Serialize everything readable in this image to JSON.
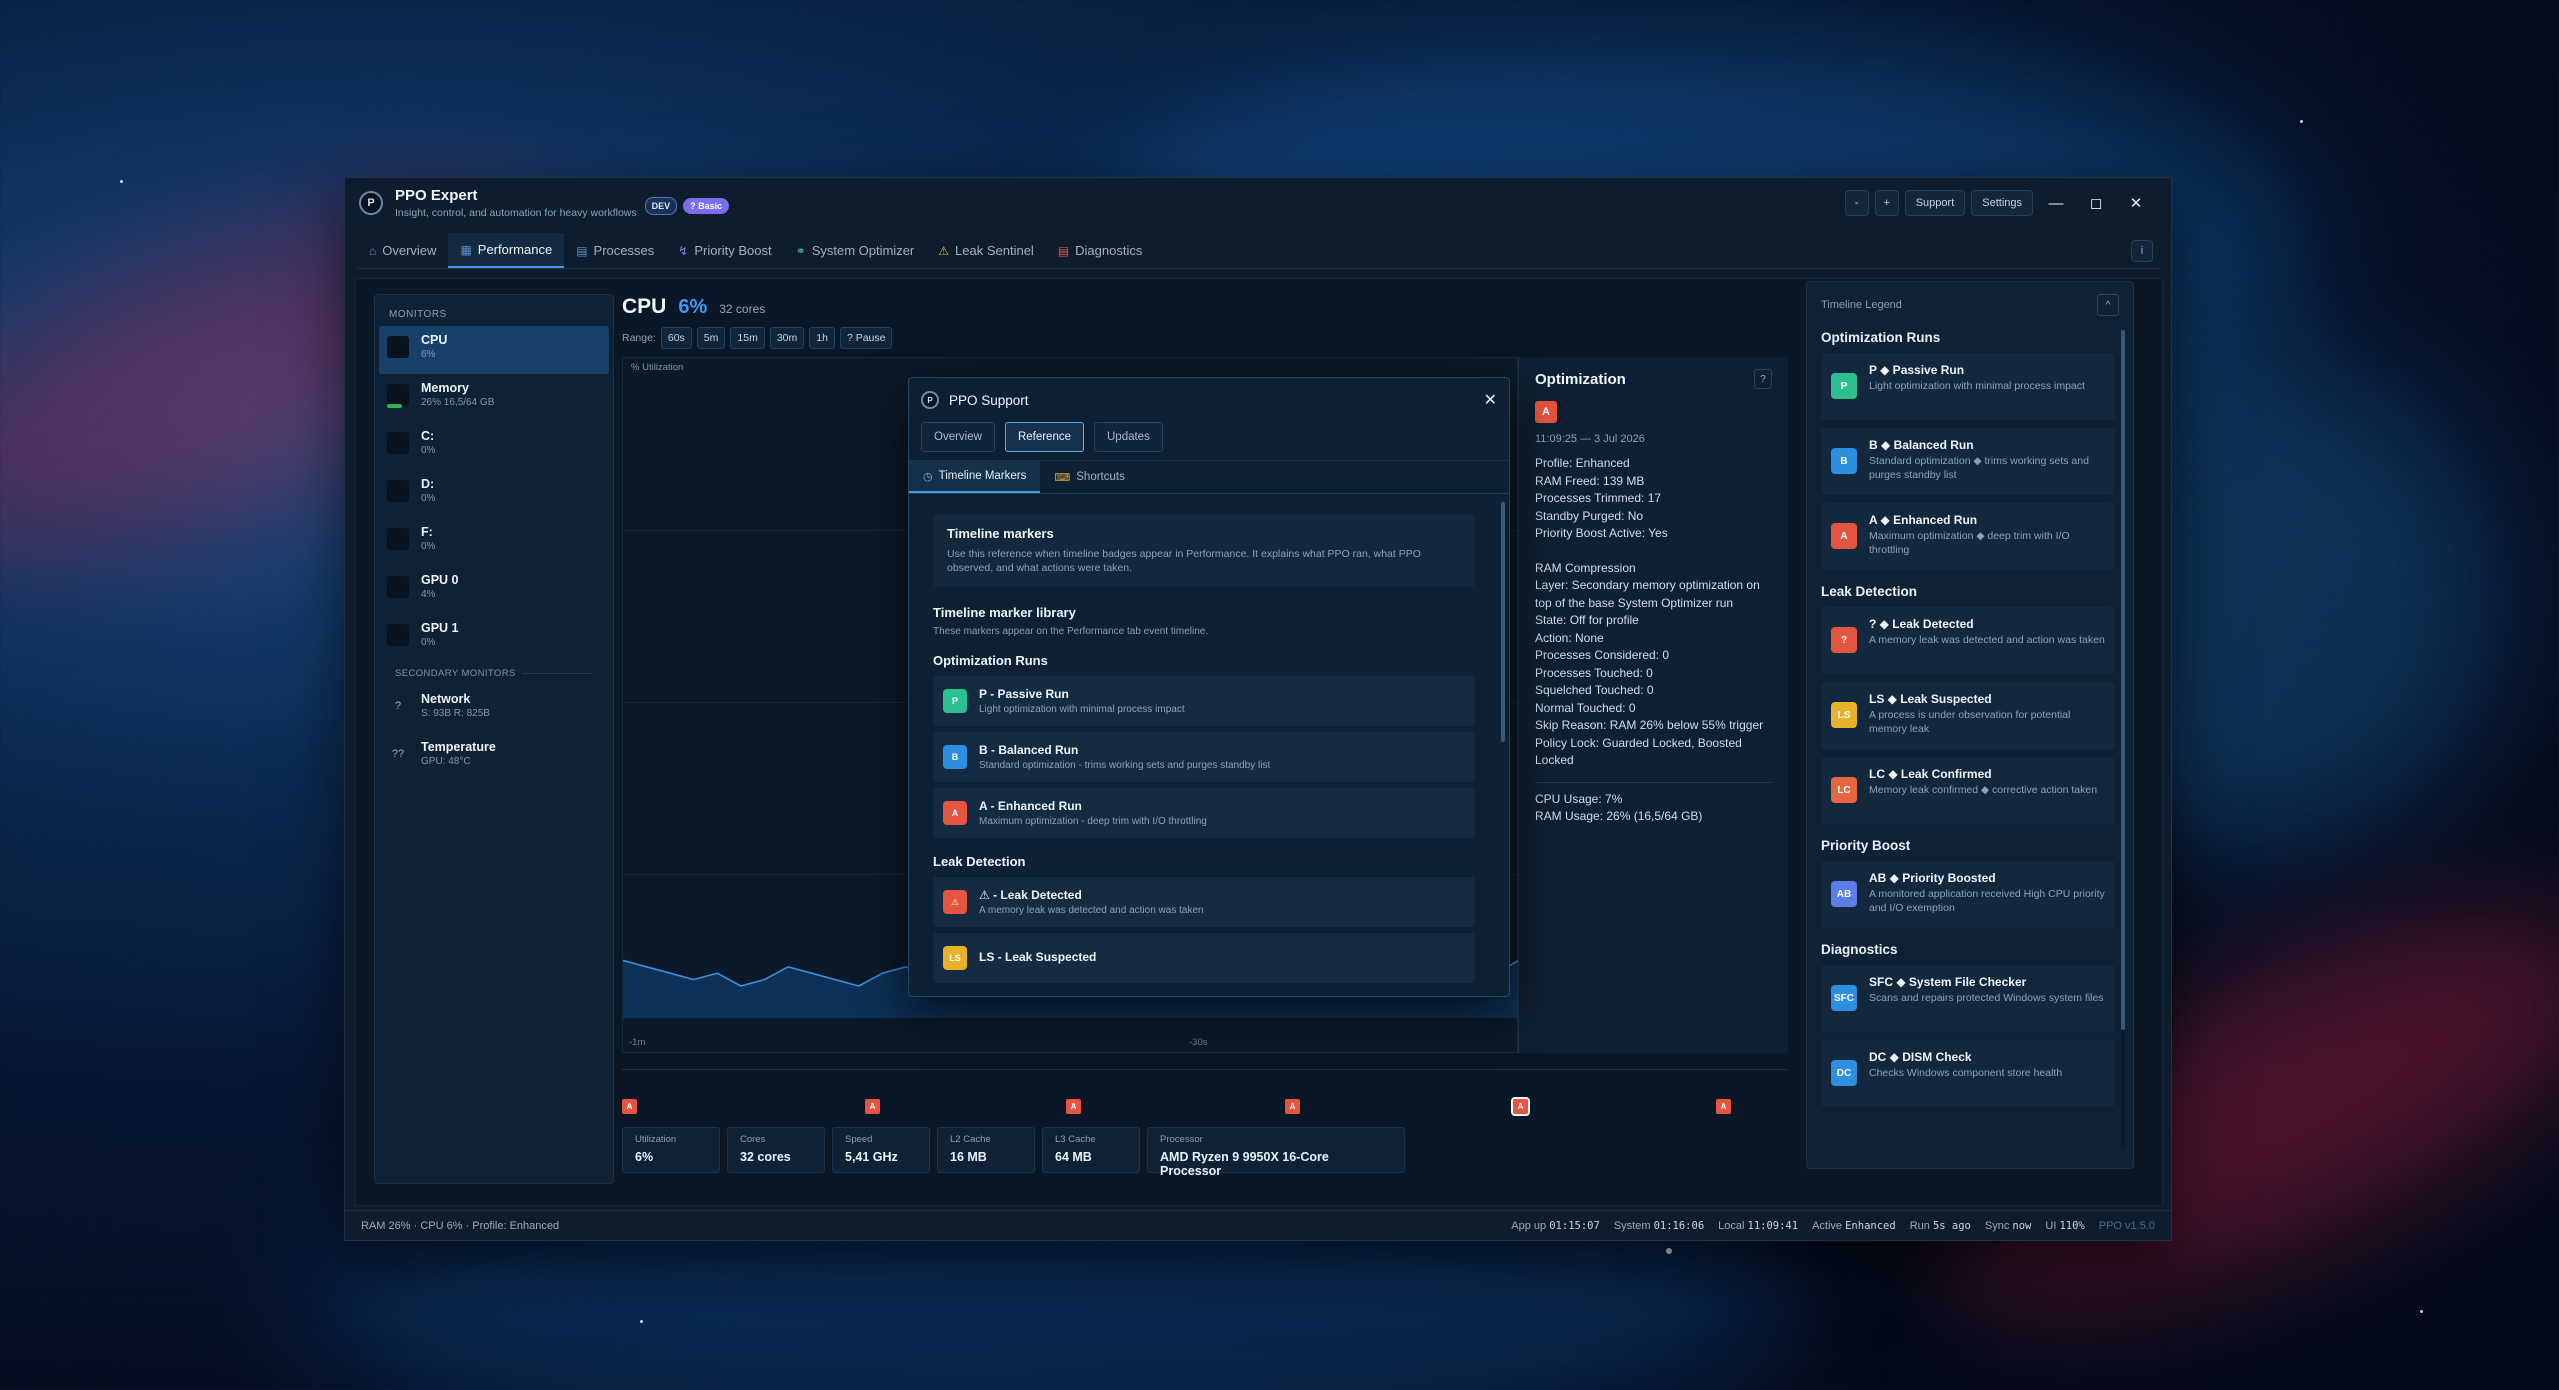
{
  "app": {
    "logo_letter": "P",
    "title": "PPO Expert",
    "subtitle": "Insight, control, and automation for heavy workflows",
    "badge_dev": "DEV",
    "badge_basic": "? Basic",
    "btn_minus": "-",
    "btn_plus": "+",
    "support_label": "Support",
    "settings_label": "Settings"
  },
  "tabs": [
    {
      "label": "Overview",
      "icon": "home-icon"
    },
    {
      "label": "Performance",
      "icon": "chart-icon",
      "active": true
    },
    {
      "label": "Processes",
      "icon": "document-icon"
    },
    {
      "label": "Priority Boost",
      "icon": "lightning-icon"
    },
    {
      "label": "System Optimizer",
      "icon": "gauge-icon"
    },
    {
      "label": "Leak Sentinel",
      "icon": "warning-icon"
    },
    {
      "label": "Diagnostics",
      "icon": "clipboard-icon"
    }
  ],
  "info_label": "i",
  "monitors": {
    "heading": "MONITORS",
    "items": [
      {
        "name": "CPU",
        "value": "6%",
        "active": true
      },
      {
        "name": "Memory",
        "value": "26%  16,5/64 GB",
        "fill_pct": 26
      },
      {
        "name": "C:",
        "value": "0%"
      },
      {
        "name": "D:",
        "value": "0%"
      },
      {
        "name": "F:",
        "value": "0%"
      },
      {
        "name": "GPU 0",
        "value": "4%"
      },
      {
        "name": "GPU 1",
        "value": "0%"
      }
    ],
    "secondary_heading": "SECONDARY MONITORS",
    "secondary": [
      {
        "name": "Network",
        "value": "S: 93B  R: 825B",
        "icon": "?"
      },
      {
        "name": "Temperature",
        "value": "GPU: 48°C",
        "icon": "??"
      }
    ]
  },
  "cpu": {
    "name": "CPU",
    "percent": "6%",
    "cores": "32 cores",
    "range_label": "Range:",
    "ranges": [
      "60s",
      "5m",
      "15m",
      "30m",
      "1h",
      "? Pause"
    ],
    "y_label": "% Utilization",
    "x_labels": [
      "-1m",
      "-30s"
    ]
  },
  "chart_data": {
    "type": "area",
    "title": "",
    "ylabel": "% Utilization",
    "ylim": [
      0,
      100
    ],
    "x_ticks": [
      "-1m",
      "-30s"
    ],
    "values": [
      9,
      8,
      7,
      6,
      7,
      5,
      6,
      8,
      7,
      6,
      5,
      7,
      8,
      6,
      5,
      6,
      7,
      6,
      5,
      6,
      7,
      8,
      6,
      7,
      6,
      7,
      6,
      5,
      6,
      7,
      8,
      7,
      6,
      7,
      8,
      7,
      6,
      7,
      9
    ]
  },
  "optimization": {
    "title": "Optimization",
    "help": "?",
    "badge": "A",
    "timestamp": "11:09:25 — 3 Jul 2026",
    "lines_a": [
      "Profile: Enhanced",
      "RAM Freed: 139 MB",
      "Processes Trimmed: 17",
      "Standby Purged: No",
      "Priority Boost Active: Yes"
    ],
    "lines_b": [
      "RAM Compression",
      "Layer: Secondary memory optimization on top of the base System Optimizer run",
      "State: Off for profile",
      "Action: None",
      "Processes Considered: 0",
      "Processes Touched: 0",
      "Squelched Touched: 0",
      "Normal Touched: 0",
      "Skip Reason: RAM 26% below 55% trigger",
      "Policy Lock: Guarded Locked, Boosted Locked"
    ],
    "lines_c": [
      "CPU Usage: 7%",
      "RAM Usage: 26% (16,5/64 GB)"
    ]
  },
  "markers": [
    "A",
    "A",
    "A",
    "A",
    "A",
    "A"
  ],
  "stats": [
    {
      "key": "Utilization",
      "value": "6%"
    },
    {
      "key": "Cores",
      "value": "32 cores"
    },
    {
      "key": "Speed",
      "value": "5,41 GHz"
    },
    {
      "key": "L2 Cache",
      "value": "16 MB"
    },
    {
      "key": "L3 Cache",
      "value": "64 MB"
    },
    {
      "key": "Processor",
      "value": "AMD Ryzen 9 9950X 16-Core Processor"
    }
  ],
  "legend": {
    "title": "Timeline Legend",
    "collapse": "^",
    "sections": [
      {
        "title": "Optimization Runs",
        "items": [
          {
            "code": "P",
            "title": "P ◆ Passive Run",
            "desc": "Light optimization with minimal process impact",
            "color": "#2cbf8f"
          },
          {
            "code": "B",
            "title": "B ◆ Balanced Run",
            "desc": "Standard optimization ◆ trims working sets and purges standby list",
            "color": "#2d8fe0"
          },
          {
            "code": "A",
            "title": "A ◆ Enhanced Run",
            "desc": "Maximum optimization ◆ deep trim with I/O throttling",
            "color": "#e5553f"
          }
        ]
      },
      {
        "title": "Leak Detection",
        "items": [
          {
            "code": "?",
            "title": "? ◆ Leak Detected",
            "desc": "A memory leak was detected and action was taken",
            "color": "#e5553f"
          },
          {
            "code": "LS",
            "title": "LS ◆ Leak Suspected",
            "desc": "A process is under observation for potential memory leak",
            "color": "#e9b12a"
          },
          {
            "code": "LC",
            "title": "LC ◆ Leak Confirmed",
            "desc": "Memory leak confirmed ◆ corrective action taken",
            "color": "#e5663f"
          }
        ]
      },
      {
        "title": "Priority Boost",
        "items": [
          {
            "code": "AB",
            "title": "AB ◆ Priority Boosted",
            "desc": "A monitored application received High CPU priority and I/O exemption",
            "color": "#5b7de8"
          }
        ]
      },
      {
        "title": "Diagnostics",
        "items": [
          {
            "code": "SFC",
            "title": "SFC ◆ System File Checker",
            "desc": "Scans and repairs protected Windows system files",
            "color": "#2d8fe0"
          },
          {
            "code": "DC",
            "title": "DC ◆ DISM Check",
            "desc": "Checks Windows component store health",
            "color": "#2d8fe0"
          }
        ]
      }
    ]
  },
  "status": {
    "left": [
      "RAM 26%",
      "CPU 6%",
      "Profile: Enhanced"
    ],
    "app_up_label": "App up",
    "app_up": "01:15:07",
    "system_label": "System",
    "system": "01:16:06",
    "local_label": "Local",
    "local": "11:09:41",
    "active_label": "Active",
    "active": "Enhanced",
    "run_label": "Run",
    "run": "5s ago",
    "sync_label": "Sync",
    "sync": "now",
    "ui_label": "UI",
    "ui": "110%",
    "version": "PPO v1.5.0"
  },
  "dialog": {
    "logo_letter": "P",
    "title": "PPO Support",
    "close": "✕",
    "tabs": [
      "Overview",
      "Reference",
      "Updates"
    ],
    "active_tab": "Reference",
    "subtabs": [
      {
        "label": "Timeline Markers",
        "icon": "clock-icon",
        "active": true
      },
      {
        "label": "Shortcuts",
        "icon": "keyboard-icon"
      }
    ],
    "intro_title": "Timeline markers",
    "intro_desc": "Use this reference when timeline badges appear in Performance. It explains what PPO ran, what PPO observed, and what actions were taken.",
    "library_title": "Timeline marker library",
    "library_desc": "These markers appear on the Performance tab event timeline.",
    "sections": [
      {
        "title": "Optimization Runs",
        "items": [
          {
            "code": "P",
            "title": "P - Passive Run",
            "desc": "Light optimization with minimal process impact",
            "color": "#2cbf8f"
          },
          {
            "code": "B",
            "title": "B - Balanced Run",
            "desc": "Standard optimization - trims working sets and purges standby list",
            "color": "#2d8fe0"
          },
          {
            "code": "A",
            "title": "A - Enhanced Run",
            "desc": "Maximum optimization - deep trim with I/O throttling",
            "color": "#e5553f"
          }
        ]
      },
      {
        "title": "Leak Detection",
        "items": [
          {
            "code": "⚠",
            "title": "⚠ - Leak Detected",
            "desc": "A memory leak was detected and action was taken",
            "color": "#e5553f"
          },
          {
            "code": "LS",
            "title": "LS - Leak Suspected",
            "desc": "",
            "color": "#e9b12a"
          }
        ]
      }
    ]
  }
}
